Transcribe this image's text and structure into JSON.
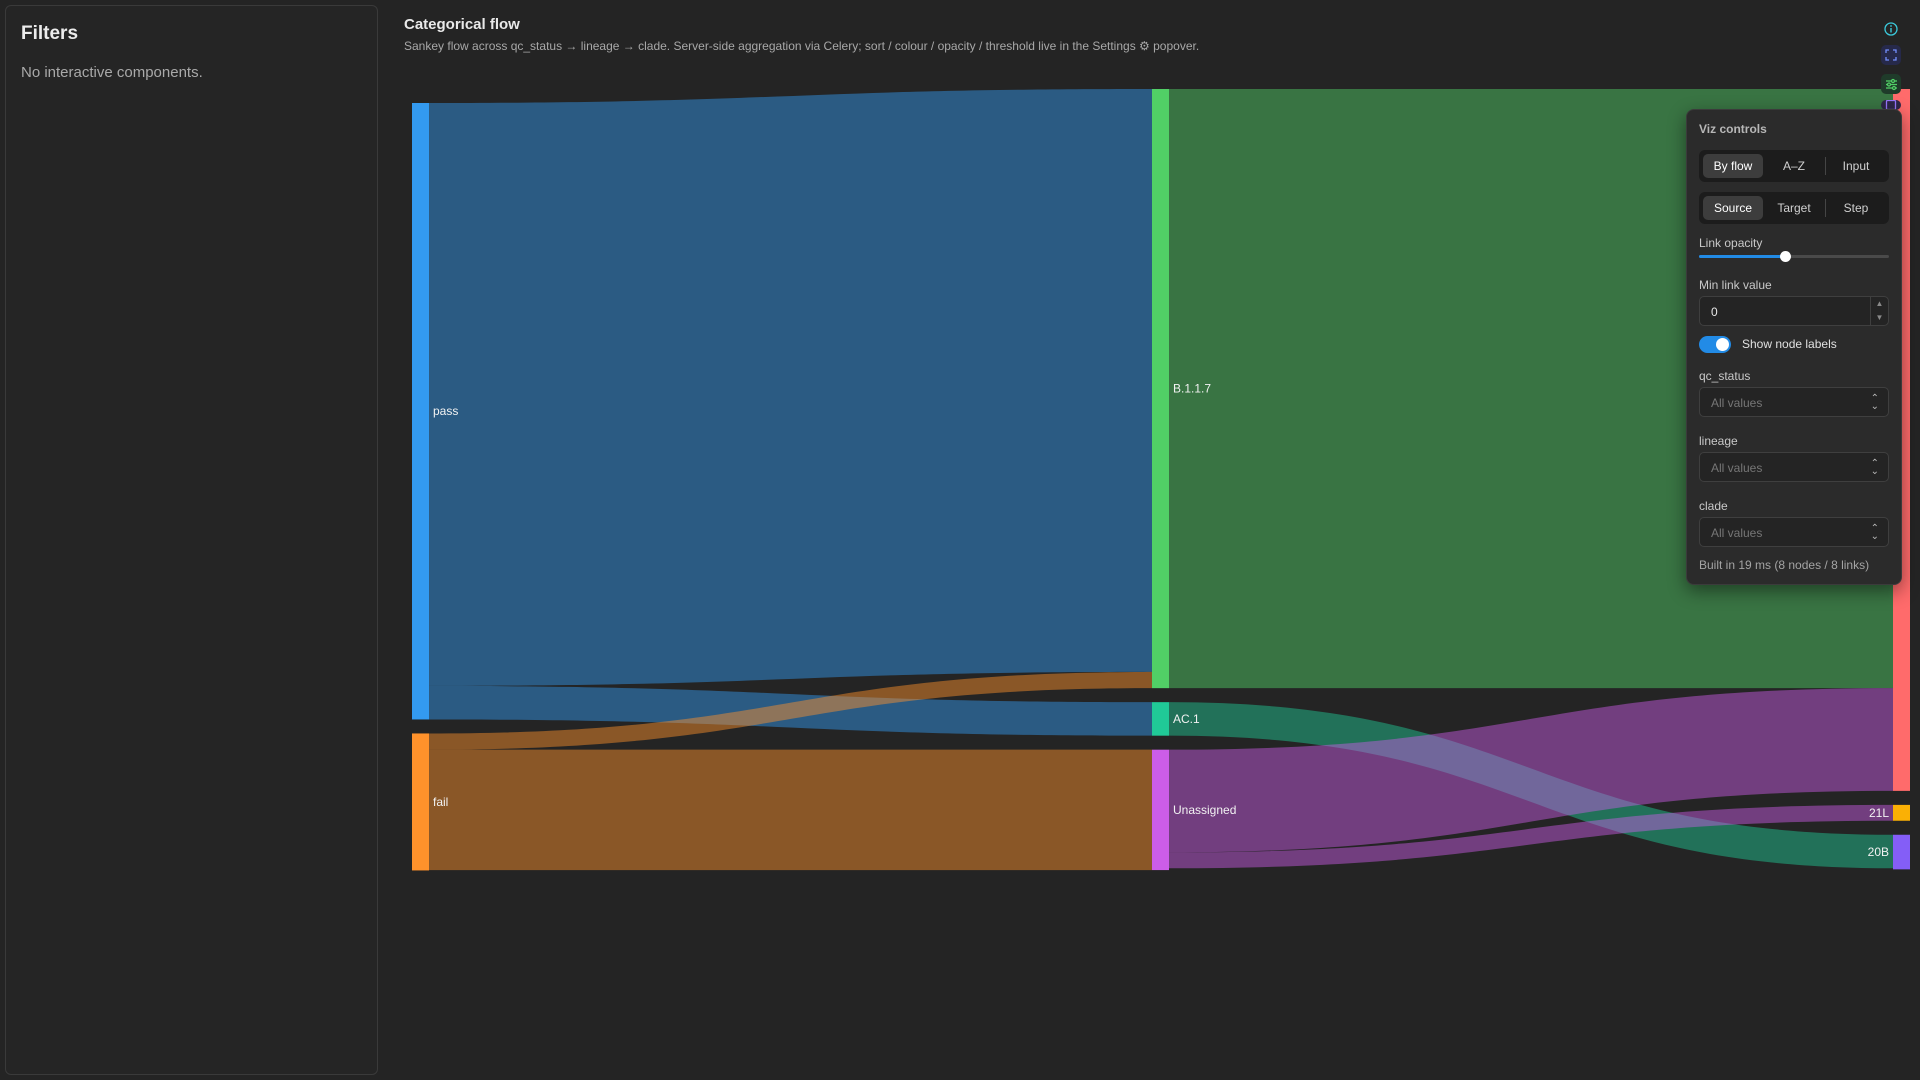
{
  "sidebar": {
    "title": "Filters",
    "empty_text": "No interactive components."
  },
  "main": {
    "title": "Categorical flow",
    "subtitle": "Sankey flow across qc_status → lineage → clade. Server-side aggregation via Celery; sort / colour / opacity / threshold live in the Settings ⚙ popover."
  },
  "toolbar": {
    "icons": [
      "info-icon",
      "expand-icon",
      "settings-sliders-icon",
      "download-icon"
    ],
    "colors": {
      "info": "#3bc9db",
      "expand": "#748ffc",
      "settings": "#51cf66",
      "download": "#9775fa"
    }
  },
  "chart_data": {
    "type": "sankey",
    "title": "",
    "stages": [
      "qc_status",
      "lineage",
      "clade"
    ],
    "nodes": [
      {
        "id": "pass",
        "label": "pass",
        "stage": 0,
        "value": 1710,
        "color": "#339af0"
      },
      {
        "id": "fail",
        "label": "fail",
        "stage": 0,
        "value": 380,
        "color": "#ff922b"
      },
      {
        "id": "B.1.1.7",
        "label": "B.1.1.7",
        "stage": 1,
        "value": 1662,
        "color": "#51cf66"
      },
      {
        "id": "AC.1",
        "label": "AC.1",
        "stage": 1,
        "value": 93,
        "color": "#20c997"
      },
      {
        "id": "Unassigned",
        "label": "Unassigned",
        "stage": 1,
        "value": 334,
        "color": "#cc5de8"
      },
      {
        "id": "20I",
        "label": "",
        "stage": 2,
        "value": 1947,
        "color": "#ff6b6b"
      },
      {
        "id": "21L",
        "label": "21L",
        "stage": 2,
        "value": 44,
        "color": "#fab005"
      },
      {
        "id": "20B",
        "label": "20B",
        "stage": 2,
        "value": 96,
        "color": "#845ef7"
      }
    ],
    "links": [
      {
        "source": "pass",
        "target": "B.1.1.7",
        "value": 1617
      },
      {
        "source": "pass",
        "target": "AC.1",
        "value": 93
      },
      {
        "source": "fail",
        "target": "B.1.1.7",
        "value": 45
      },
      {
        "source": "fail",
        "target": "Unassigned",
        "value": 334
      },
      {
        "source": "B.1.1.7",
        "target": "20I",
        "value": 1662
      },
      {
        "source": "AC.1",
        "target": "20B",
        "value": 93
      },
      {
        "source": "Unassigned",
        "target": "20I",
        "value": 285
      },
      {
        "source": "Unassigned",
        "target": "21L",
        "value": 44
      }
    ]
  },
  "panel": {
    "title": "Viz controls",
    "sort_options": [
      "By flow",
      "A–Z",
      "Input"
    ],
    "sort_selected": 0,
    "colour_options": [
      "Source",
      "Target",
      "Step"
    ],
    "colour_selected": 0,
    "opacity_label": "Link opacity",
    "opacity_value": 0.45,
    "min_link_label": "Min link value",
    "min_link_value": "0",
    "show_labels_label": "Show node labels",
    "show_labels_on": true,
    "filters": [
      {
        "label": "qc_status",
        "placeholder": "All values"
      },
      {
        "label": "lineage",
        "placeholder": "All values"
      },
      {
        "label": "clade",
        "placeholder": "All values"
      }
    ],
    "footer": "Built in 19 ms (8 nodes / 8 links)"
  }
}
